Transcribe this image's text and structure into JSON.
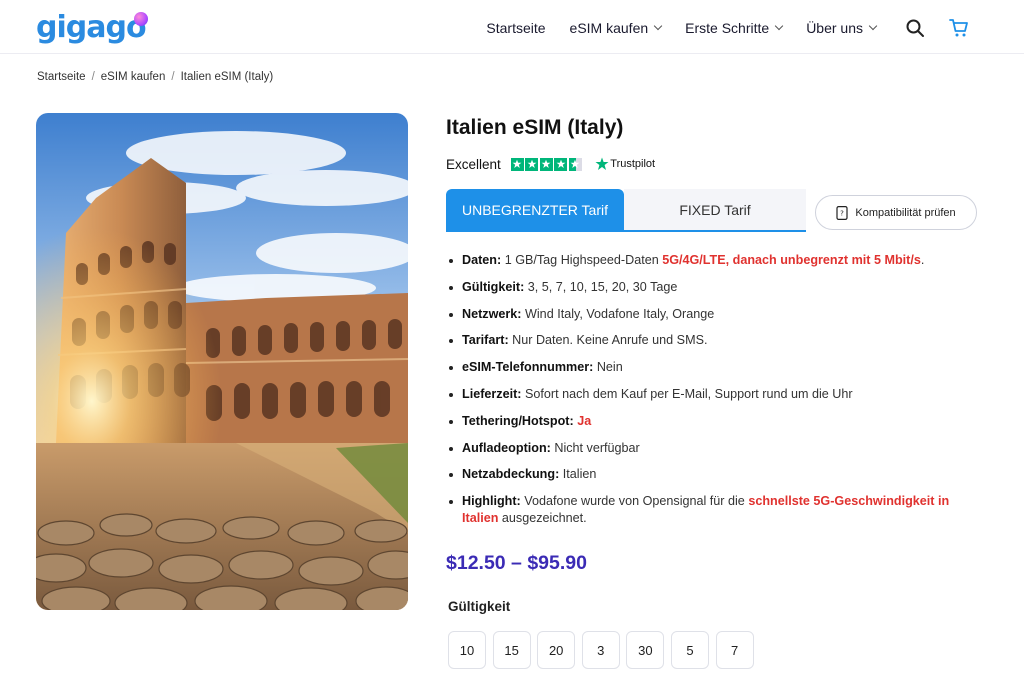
{
  "header": {
    "logo_text": "gigago",
    "nav": [
      {
        "label": "Startseite",
        "has_dropdown": false
      },
      {
        "label": "eSIM kaufen",
        "has_dropdown": true
      },
      {
        "label": "Erste Schritte",
        "has_dropdown": true
      },
      {
        "label": "Über uns",
        "has_dropdown": true
      }
    ],
    "icons": [
      "search-icon",
      "cart-icon"
    ]
  },
  "breadcrumb": [
    "Startseite",
    "eSIM kaufen",
    "Italien eSIM (Italy)"
  ],
  "product": {
    "title": "Italien eSIM (Italy)",
    "rating_label": "Excellent",
    "rating_stars": 4.5,
    "trustpilot": "Trustpilot",
    "image_alt": "Colosseum in Rome at sunrise"
  },
  "tabs": {
    "active": "UNBEGRENZTER Tarif",
    "inactive": "FIXED Tarif"
  },
  "compat_button": "Kompatibilität prüfen",
  "features": [
    {
      "key": "Daten:",
      "text": "1 GB/Tag Highspeed-Daten",
      "highlight": "5G/4G/LTE, danach unbegrenzt mit 5 Mbit/s",
      "after": "."
    },
    {
      "key": "Gültigkeit:",
      "text": "3, 5, 7, 10, 15, 20, 30 Tage"
    },
    {
      "key": "Netzwerk:",
      "text": "Wind Italy, Vodafone Italy, Orange"
    },
    {
      "key": "Tarifart:",
      "text": "Nur Daten. Keine Anrufe und SMS."
    },
    {
      "key": "eSIM-Telefonnummer:",
      "text": "Nein"
    },
    {
      "key": "Lieferzeit:",
      "text": "Sofort nach dem Kauf per E-Mail, Support rund um die Uhr"
    },
    {
      "key": "Tethering/Hotspot:",
      "text": "",
      "highlight": "Ja"
    },
    {
      "key": "Aufladeoption:",
      "text": "Nicht verfügbar"
    },
    {
      "key": "Netzabdeckung:",
      "text": "Italien"
    },
    {
      "key": "Highlight:",
      "text": "Vodafone wurde von Opensignal für die",
      "highlight": "schnellste 5G-Geschwindigkeit in Italien",
      "after": "ausgezeichnet."
    }
  ],
  "price": "$12.50 – $95.90",
  "validity": {
    "label": "Gültigkeit",
    "options": [
      "10",
      "15",
      "20",
      "3",
      "30",
      "5",
      "7"
    ]
  },
  "colors": {
    "accent_blue": "#1e90e8",
    "price_purple": "#3b2bb5",
    "highlight_red": "#e0322f",
    "trustpilot_green": "#00b67a"
  }
}
